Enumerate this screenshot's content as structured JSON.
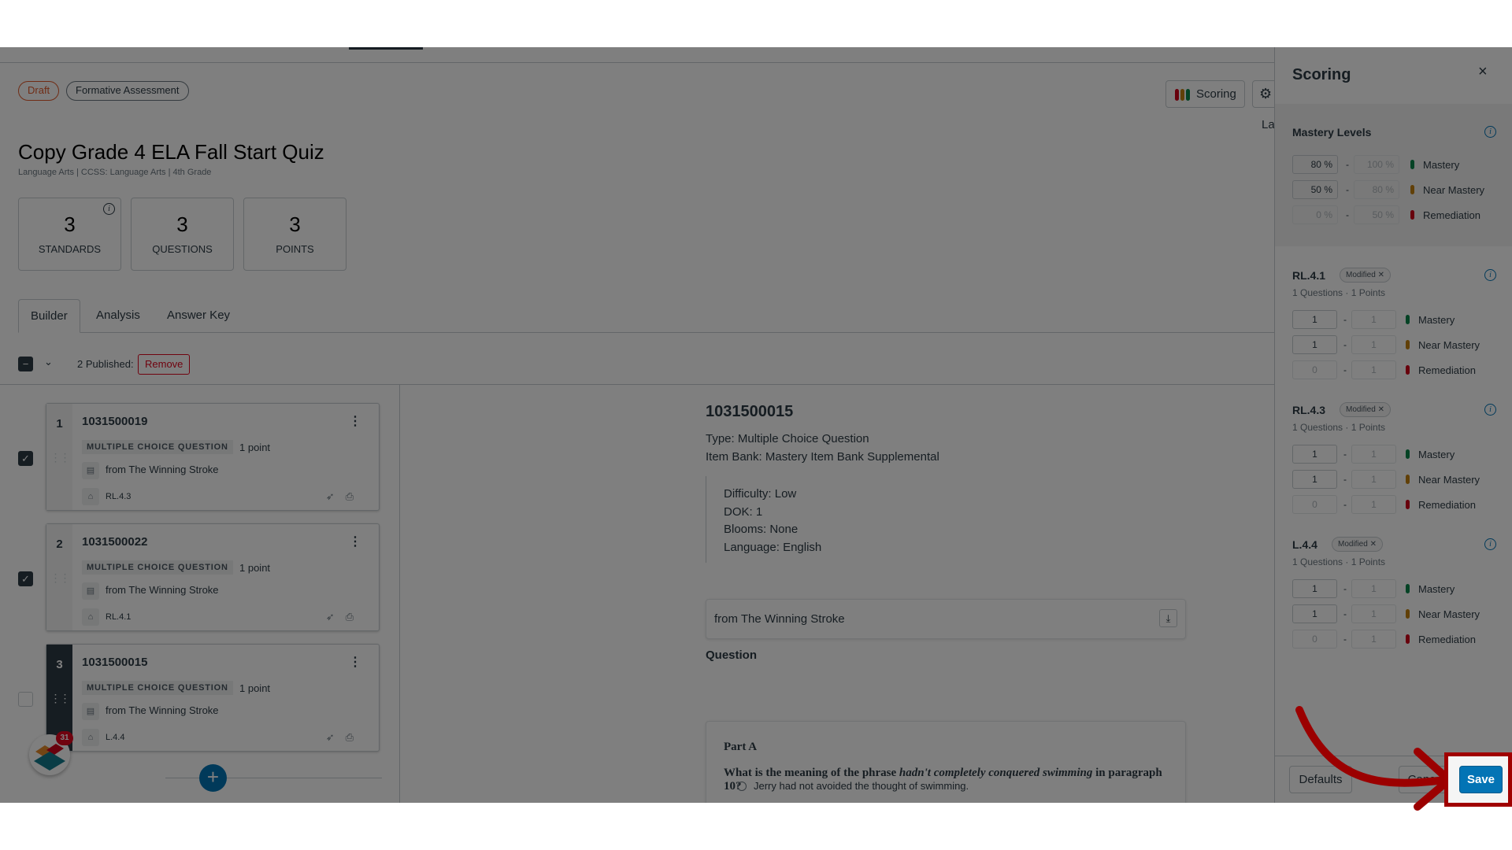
{
  "header": {
    "badges": {
      "draft": "Draft",
      "type": "Formative Assessment"
    },
    "title": "Copy Grade 4 ELA Fall Start Quiz",
    "subtitle": "Language Arts | CCSS: Language Arts | 4th Grade",
    "scoring_button": "Scoring",
    "cut_text": "La"
  },
  "stats": [
    {
      "value": "3",
      "label": "STANDARDS"
    },
    {
      "value": "3",
      "label": "QUESTIONS"
    },
    {
      "value": "3",
      "label": "POINTS"
    }
  ],
  "tabs": [
    "Builder",
    "Analysis",
    "Answer Key"
  ],
  "bulk": {
    "published": "2 Published:",
    "remove": "Remove"
  },
  "questions": [
    {
      "num": "1",
      "id": "1031500019",
      "type": "MULTIPLE CHOICE QUESTION",
      "points": "1 point",
      "source": "from The Winning Stroke",
      "standard": "RL.4.3",
      "checked": true
    },
    {
      "num": "2",
      "id": "1031500022",
      "type": "MULTIPLE CHOICE QUESTION",
      "points": "1 point",
      "source": "from The Winning Stroke",
      "standard": "RL.4.1",
      "checked": true
    },
    {
      "num": "3",
      "id": "1031500015",
      "type": "MULTIPLE CHOICE QUESTION",
      "points": "1 point",
      "source": "from The Winning Stroke",
      "standard": "L.4.4",
      "checked": false
    }
  ],
  "notification_count": "31",
  "detail": {
    "id": "1031500015",
    "type": "Type: Multiple Choice Question",
    "bank": "Item Bank: Mastery Item Bank Supplemental",
    "meta": [
      "Difficulty: Low",
      "DOK: 1",
      "Blooms: None",
      "Language: English"
    ],
    "passage": "from The Winning Stroke",
    "question_heading": "Question",
    "part": "Part A",
    "q_pre": "What is the meaning of the phrase ",
    "q_em": "hadn't completely conquered swimming",
    "q_post": " in paragraph 10?",
    "option1": "Jerry had not avoided the thought of swimming."
  },
  "scoring": {
    "title": "Scoring",
    "close": "×",
    "mastery_title": "Mastery Levels",
    "levels": [
      {
        "from": "80",
        "to": "100",
        "label": "Mastery"
      },
      {
        "from": "50",
        "to": "80",
        "label": "Near Mastery"
      },
      {
        "from": "0",
        "to": "50",
        "label": "Remediation"
      }
    ],
    "percent": "%",
    "dash": "-",
    "standards": [
      {
        "code": "RL.4.1",
        "modified": "Modified ✕",
        "summary": "1 Questions · 1 Points",
        "rows": [
          {
            "from": "1",
            "to": "1",
            "label": "Mastery"
          },
          {
            "from": "1",
            "to": "1",
            "label": "Near Mastery"
          },
          {
            "from": "0",
            "to": "1",
            "label": "Remediation"
          }
        ]
      },
      {
        "code": "RL.4.3",
        "modified": "Modified ✕",
        "summary": "1 Questions · 1 Points",
        "rows": [
          {
            "from": "1",
            "to": "1",
            "label": "Mastery"
          },
          {
            "from": "1",
            "to": "1",
            "label": "Near Mastery"
          },
          {
            "from": "0",
            "to": "1",
            "label": "Remediation"
          }
        ]
      },
      {
        "code": "L.4.4",
        "modified": "Modified ✕",
        "summary": "1 Questions · 1 Points",
        "rows": [
          {
            "from": "1",
            "to": "1",
            "label": "Mastery"
          },
          {
            "from": "1",
            "to": "1",
            "label": "Near Mastery"
          },
          {
            "from": "0",
            "to": "1",
            "label": "Remediation"
          }
        ]
      }
    ],
    "defaults": "Defaults",
    "cancel": "Cancel",
    "save": "Save"
  },
  "colors": {
    "mastery": "#0b874b",
    "near": "#c28110",
    "remediation": "#d0021b",
    "primary": "#0374b5",
    "highlight": "#a00000"
  }
}
